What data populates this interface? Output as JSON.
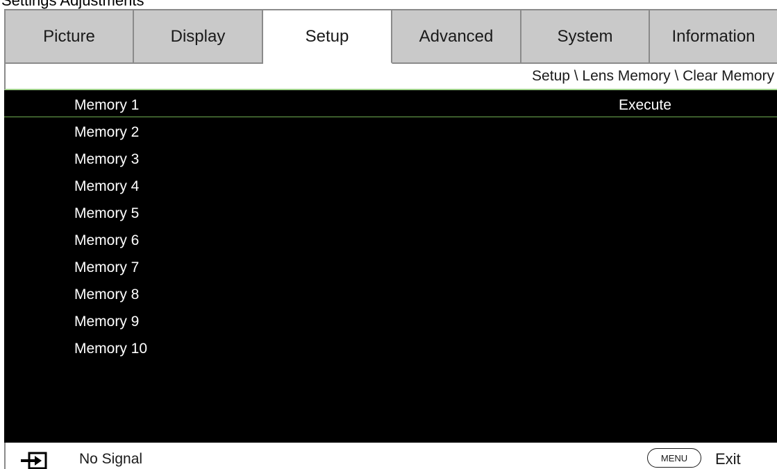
{
  "top_strip": {
    "text": "Settings Adjustments"
  },
  "tabs": [
    {
      "label": "Picture"
    },
    {
      "label": "Display"
    },
    {
      "label": "Setup"
    },
    {
      "label": "Advanced"
    },
    {
      "label": "System"
    },
    {
      "label": "Information"
    }
  ],
  "active_tab": "Setup",
  "breadcrumb": "Setup \\ Lens Memory \\ Clear Memory",
  "menu": {
    "items": [
      {
        "label": "Memory 1",
        "value": "Execute"
      },
      {
        "label": "Memory 2",
        "value": ""
      },
      {
        "label": "Memory 3",
        "value": ""
      },
      {
        "label": "Memory 4",
        "value": ""
      },
      {
        "label": "Memory 5",
        "value": ""
      },
      {
        "label": "Memory 6",
        "value": ""
      },
      {
        "label": "Memory 7",
        "value": ""
      },
      {
        "label": "Memory 8",
        "value": ""
      },
      {
        "label": "Memory 9",
        "value": ""
      },
      {
        "label": "Memory 10",
        "value": ""
      }
    ],
    "selected_index": 0
  },
  "status": {
    "input_icon": "input-source-icon",
    "signal_text": "No Signal",
    "menu_key_label": "MENU",
    "exit_label": "Exit"
  },
  "colors": {
    "tab_inactive": "#c9c9c9",
    "tab_active": "#ffffff",
    "menu_background": "#000000",
    "selection_line": "#6fae52"
  }
}
